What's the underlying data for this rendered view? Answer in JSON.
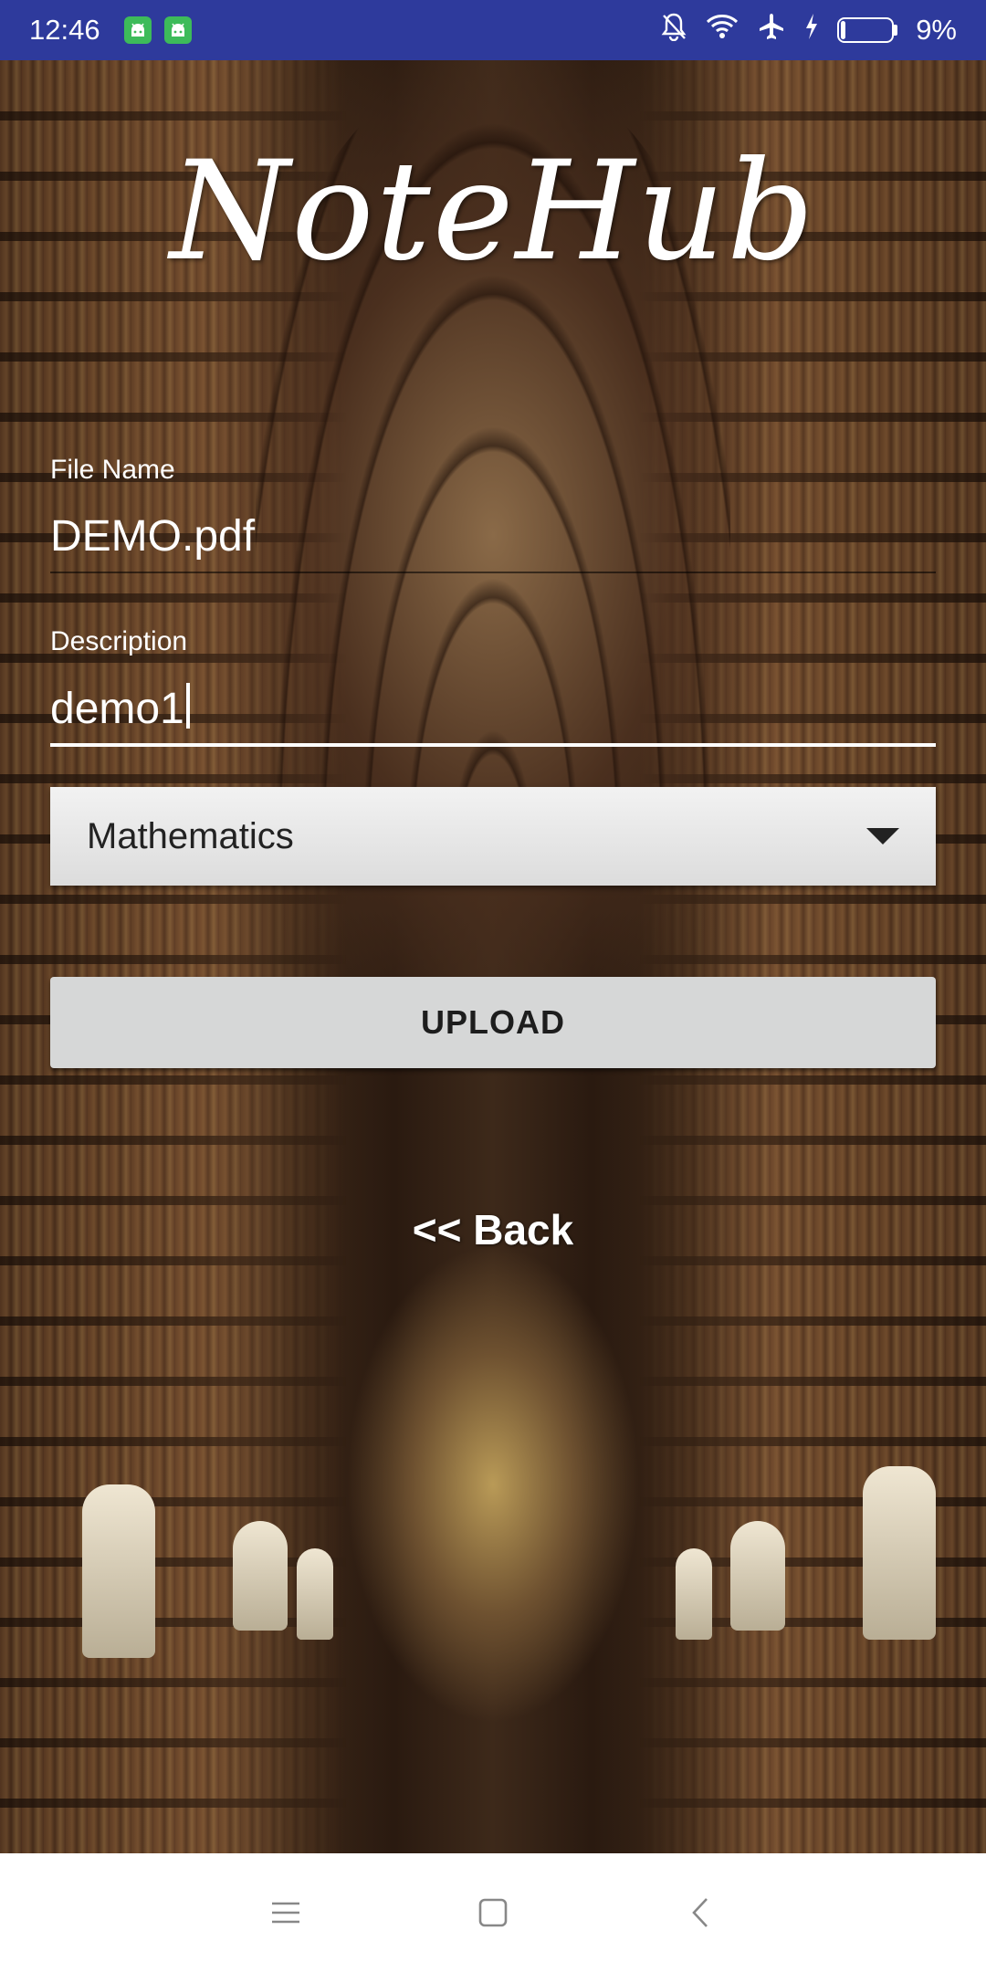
{
  "status_bar": {
    "time": "12:46",
    "battery_percent": "9%",
    "battery_level": 0.09,
    "icons": [
      "android-notification-icon",
      "android-notification-icon",
      "mute-bell-icon",
      "wifi-icon",
      "airplane-icon",
      "charging-icon",
      "battery-icon"
    ],
    "background_color": "#2e3a9c"
  },
  "app": {
    "logo_text": "NoteHub"
  },
  "form": {
    "file_name_label": "File Name",
    "file_name_value": "DEMO.pdf",
    "description_label": "Description",
    "description_value": "demo1",
    "subject_selected": "Mathematics",
    "upload_label": "UPLOAD",
    "back_label": "<< Back"
  },
  "nav_bar": {
    "buttons": [
      "menu-icon",
      "home-icon",
      "back-icon"
    ]
  },
  "colors": {
    "button_bg": "#d6d7d7",
    "text_light": "#ffffff"
  }
}
